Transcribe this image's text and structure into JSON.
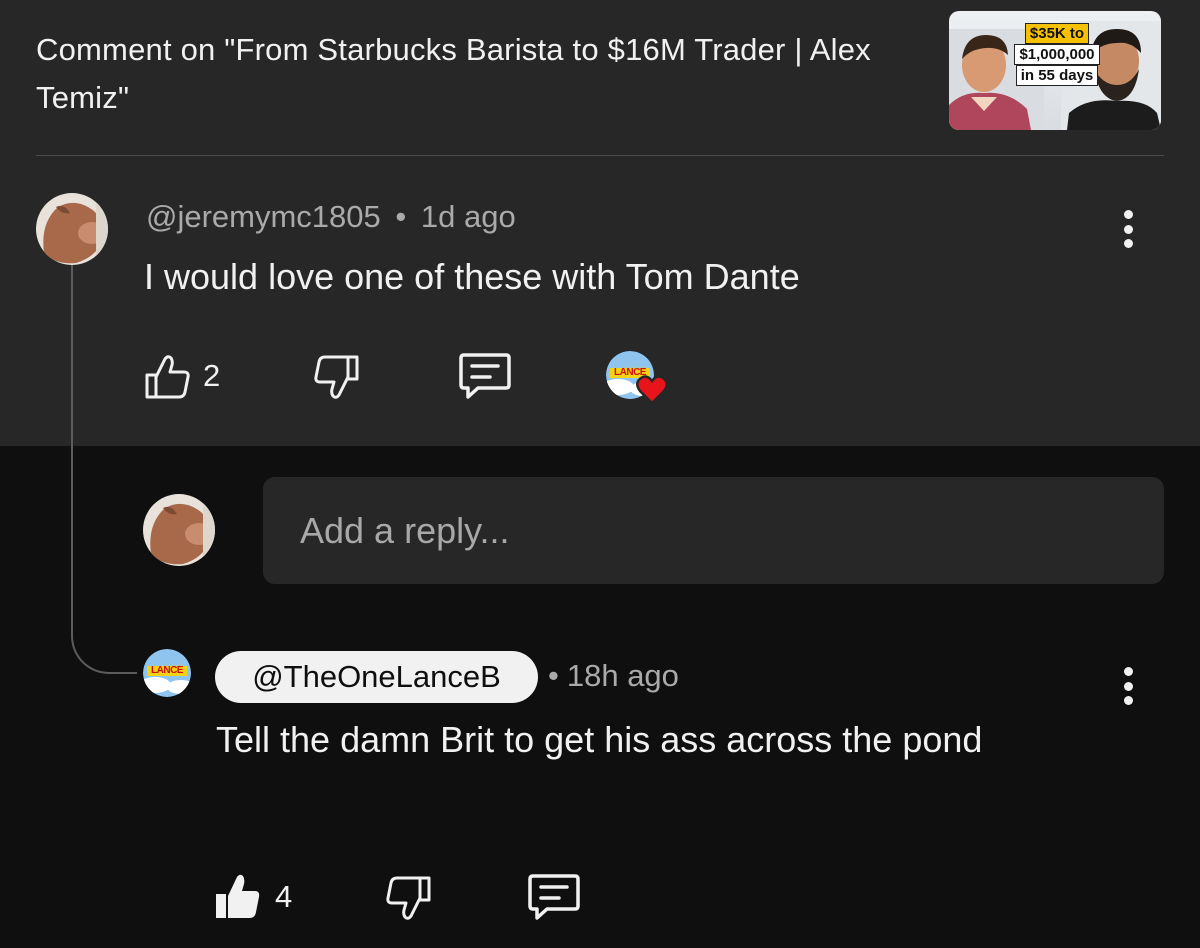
{
  "header": {
    "title": "Comment on \"From Starbucks Barista to $16M Trader | Alex Temiz\"",
    "thumbnail": {
      "line1": "$35K to",
      "line2": "$1,000,000",
      "line3": "in 55 days"
    }
  },
  "comment": {
    "author": "@jeremymc1805",
    "separator": "•",
    "age": "1d ago",
    "text": "I would love one of these with Tom Dante",
    "likes": "2",
    "creator_heart_badge": "LANCE"
  },
  "reply_box": {
    "placeholder": "Add a reply..."
  },
  "reply": {
    "author": "@TheOneLanceB",
    "separator": "•",
    "age": "18h ago",
    "text": "Tell the damn Brit to get his ass across the pond",
    "likes": "4",
    "avatar_badge": "LANCE"
  },
  "colors": {
    "panel": "#272727",
    "background": "#0f0f0f",
    "text": "#f1f1f1",
    "muted": "#aaaaaa",
    "heart": "#e8141c"
  }
}
